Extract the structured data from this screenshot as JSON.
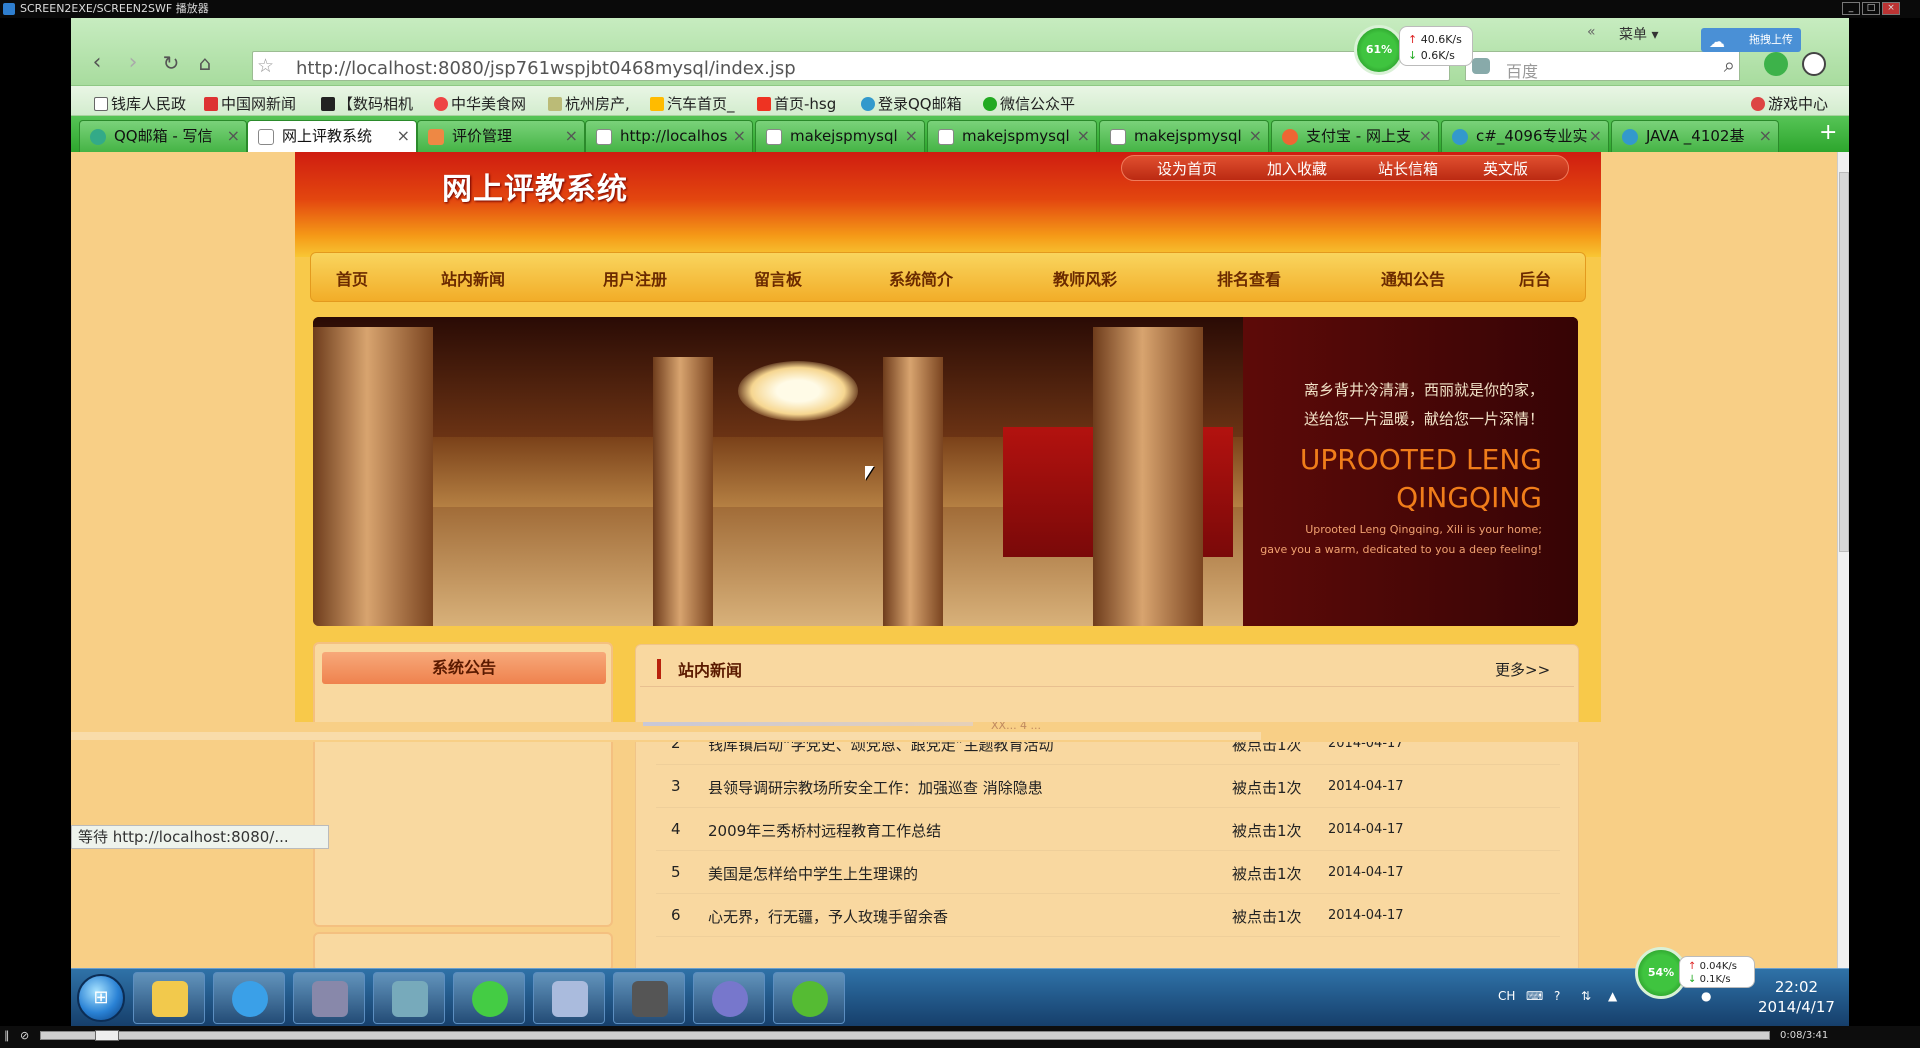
{
  "player": {
    "title": "SCREEN2EXE/SCREEN2SWF 播放器",
    "time": "0:08/3:41"
  },
  "browser": {
    "url": "http://localhost:8080/jsp761wspjbt0468mysql/index.jsp",
    "search_placeholder": "百度",
    "menu_label": "菜单",
    "upload_label": "拖拽上传",
    "net_percent": "61%",
    "net_up": "40.6K/s",
    "net_down": "0.6K/s",
    "status_text": "等待 http://localhost:8080/...",
    "bookmarks": [
      "钱库人民政",
      "中国网新闻",
      "【数码相机",
      "中华美食网",
      "杭州房产,",
      "汽车首页_",
      "首页-hsg",
      "登录QQ邮箱",
      "微信公众平"
    ],
    "bookmark_right": "游戏中心",
    "tabs": [
      {
        "label": "QQ邮箱 - 写信",
        "active": false
      },
      {
        "label": "网上评教系统",
        "active": true
      },
      {
        "label": "评价管理",
        "active": false
      },
      {
        "label": "http://localhos",
        "active": false
      },
      {
        "label": "makejspmysql",
        "active": false
      },
      {
        "label": "makejspmysql",
        "active": false
      },
      {
        "label": "makejspmysql",
        "active": false
      },
      {
        "label": "支付宝 - 网上支",
        "active": false
      },
      {
        "label": "c#_4096专业实",
        "active": false
      },
      {
        "label": "JAVA _4102基",
        "active": false
      }
    ]
  },
  "site": {
    "title": "网上评教系统",
    "toplinks": [
      "设为首页",
      "加入收藏",
      "站长信箱",
      "英文版"
    ],
    "nav": [
      "首页",
      "站内新闻",
      "用户注册",
      "留言板",
      "系统简介",
      "教师风彩",
      "排名查看",
      "通知公告",
      "后台"
    ],
    "banner": {
      "cn_line1": "离乡背井冷清清，西丽就是你的家，",
      "cn_line2": "送给您一片温暖，献给您一片深情！",
      "en_big1": "UPROOTED LENG",
      "en_big2": "QINGQING",
      "en_small1": "Uprooted Leng Qingqing, Xili is your home;",
      "en_small2": "gave you a warm, dedicated to you a deep feeling!"
    },
    "sidebar_title": "系统公告",
    "news_title": "站内新闻",
    "news_more": "更多>>",
    "news_partial": "XX... 4 ...",
    "news": [
      {
        "n": "2",
        "title": "钱库镇启动“学党史、颂党恩、跟党走”主题教育活动",
        "clicks": "被点击1次",
        "date": "2014-04-17"
      },
      {
        "n": "3",
        "title": "县领导调研宗教场所安全工作：加强巡查 消除隐患",
        "clicks": "被点击1次",
        "date": "2014-04-17"
      },
      {
        "n": "4",
        "title": "2009年三秀桥村远程教育工作总结",
        "clicks": "被点击1次",
        "date": "2014-04-17"
      },
      {
        "n": "5",
        "title": "美国是怎样给中学生上生理课的",
        "clicks": "被点击1次",
        "date": "2014-04-17"
      },
      {
        "n": "6",
        "title": "心无界，行无疆，予人玫瑰手留余香",
        "clicks": "被点击1次",
        "date": "2014-04-17"
      }
    ]
  },
  "taskbar": {
    "lang": "CH",
    "time": "22:02",
    "date": "2014/4/17",
    "net_percent": "54%",
    "net_up": "0.04K/s",
    "net_down": "0.1K/s"
  },
  "colors": {
    "page_bg": "#f8cf86",
    "header_red": "#cf1d10",
    "nav_gold": "#f2ad28",
    "browser_green": "#a8dc9e",
    "banner_accent": "#f07d1a"
  }
}
